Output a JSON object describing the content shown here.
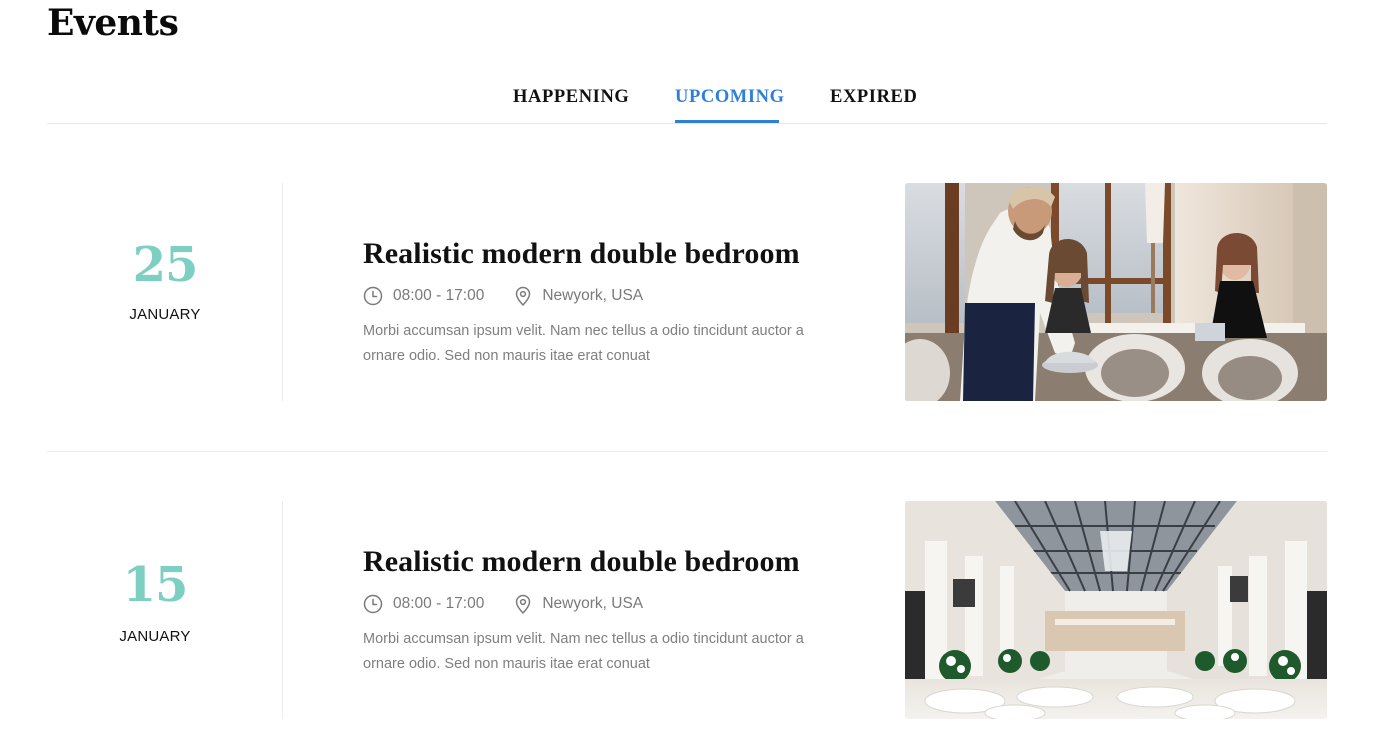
{
  "page": {
    "title": "Events"
  },
  "tabs": [
    {
      "label": "HAPPENING",
      "active": false
    },
    {
      "label": "UPCOMING",
      "active": true
    },
    {
      "label": "EXPIRED",
      "active": false
    }
  ],
  "colors": {
    "accent": "#2f7fd8",
    "date": "#7dcfc1",
    "muted": "#7a7a7a"
  },
  "events": [
    {
      "day": "25",
      "month": "JANUARY",
      "title": "Realistic modern double bedroom",
      "time": "08:00 - 17:00",
      "location": "Newyork, USA",
      "description": "Morbi accumsan ipsum velit. Nam nec tellus a odio tincidunt auctor a ornare odio. Sed non mauris itae erat conuat",
      "image": "restaurant-dining-photo"
    },
    {
      "day": "15",
      "month": "JANUARY",
      "title": "Realistic modern double bedroom",
      "time": "08:00 - 17:00",
      "location": "Newyork, USA",
      "description": "Morbi accumsan ipsum velit. Nam nec tellus a odio tincidunt auctor a ornare odio. Sed non mauris itae erat conuat",
      "image": "banquet-hall-photo"
    }
  ],
  "icons": {
    "time": "clock-icon",
    "location": "map-pin-icon"
  }
}
